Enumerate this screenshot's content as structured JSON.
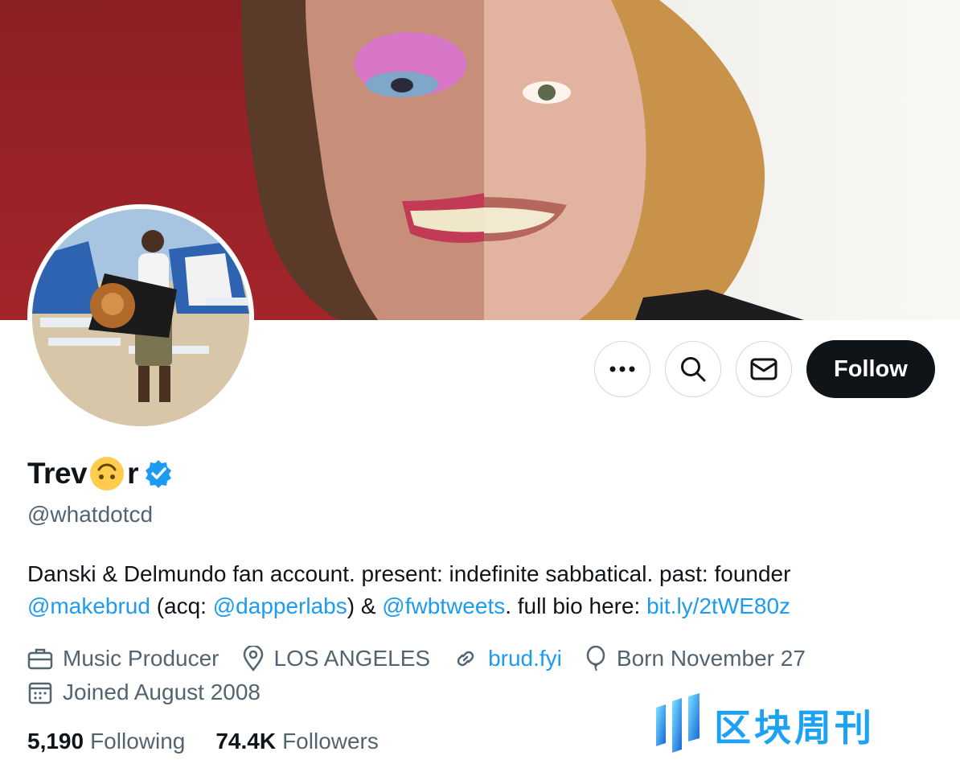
{
  "profile": {
    "name_part1": "Trev",
    "name_part2": "r",
    "name_emoji": "upside-down-face-emoji",
    "handle": "@whatdotcd",
    "verified": true
  },
  "actions": {
    "more_icon": "more-icon",
    "search_icon": "search-icon",
    "message_icon": "mail-icon",
    "follow_label": "Follow"
  },
  "bio": {
    "line1": "Danski & Delmundo fan account. present: indefinite sabbatical. past: founder",
    "mention1": "@makebrud",
    "text_acq": " (acq: ",
    "mention2": "@dapperlabs",
    "text_amp": ") & ",
    "mention3": "@fwbtweets",
    "text_full": ". full bio here: ",
    "link": "bit.ly/2tWE80z"
  },
  "meta": {
    "profession": "Music Producer",
    "location": "LOS ANGELES",
    "website": "brud.fyi",
    "birthday": "Born November 27",
    "joined": "Joined August 2008"
  },
  "stats": {
    "following_count": "5,190",
    "following_label": "Following",
    "followers_count": "74.4K",
    "followers_label": "Followers"
  },
  "watermark": {
    "text": "区块周刊"
  },
  "colors": {
    "accent": "#1d9bf0",
    "text": "#0f1419",
    "muted": "#536471",
    "verified": "#1d9bf0"
  }
}
